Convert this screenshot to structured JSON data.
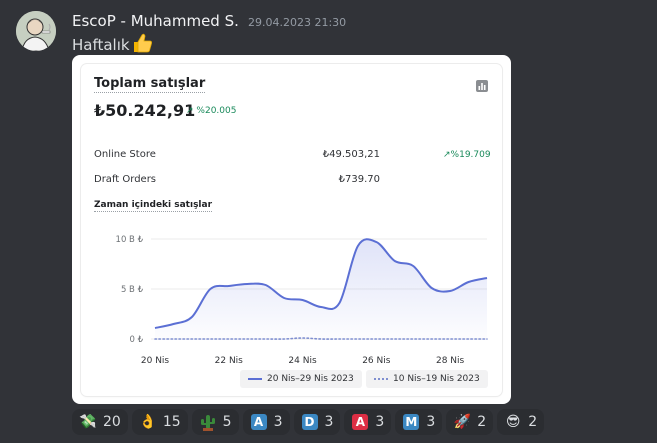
{
  "message": {
    "username": "EscoP - Muhammed S.",
    "timestamp": "29.04.2023 21:30",
    "text": "Haftalık",
    "emoji_icon": "thumbs-up-icon"
  },
  "card": {
    "title": "Toplam satışlar",
    "total": "₺50.242,91",
    "total_change": "%20.005",
    "rows": [
      {
        "label": "Online Store",
        "value": "₺49.503,21",
        "change": "%19.709"
      },
      {
        "label": "Draft Orders",
        "value": "₺739.70",
        "change": ""
      }
    ],
    "subtitle": "Zaman içindeki satışlar",
    "legend": [
      {
        "label": "20 Nis–29 Nis 2023"
      },
      {
        "label": "10 Nis–19 Nis 2023"
      }
    ]
  },
  "chart_data": {
    "type": "line",
    "x": [
      20,
      20.5,
      21,
      21.5,
      22,
      22.5,
      23,
      23.5,
      24,
      24.5,
      25,
      25.5,
      26,
      26.5,
      27,
      27.5,
      28,
      28.5,
      29
    ],
    "x_tick_labels": [
      "20 Nis",
      "22 Nis",
      "24 Nis",
      "26 Nis",
      "28 Nis"
    ],
    "x_tick_values": [
      20,
      22,
      24,
      26,
      28
    ],
    "y_tick_labels": [
      "10 B ₺",
      "5 B ₺",
      "0 ₺"
    ],
    "y_tick_values": [
      10000,
      5000,
      0
    ],
    "ylim": [
      0,
      10000
    ],
    "series": [
      {
        "name": "20 Nis–29 Nis 2023",
        "color": "#5b6fd4",
        "values": [
          1100,
          1500,
          2200,
          5000,
          5300,
          5500,
          5400,
          4100,
          3900,
          3200,
          3600,
          9300,
          9700,
          7800,
          7300,
          5100,
          4800,
          5700,
          6100
        ]
      },
      {
        "name": "10 Nis–19 Nis 2023",
        "color": "#7f8fd0",
        "values": [
          0,
          0,
          0,
          0,
          0,
          0,
          0,
          0,
          100,
          0,
          0,
          0,
          0,
          0,
          0,
          0,
          0,
          0,
          0
        ]
      }
    ]
  },
  "reactions": [
    {
      "icon": "money-with-wings-icon",
      "count": "20"
    },
    {
      "icon": "ok-hand-icon",
      "count": "15"
    },
    {
      "icon": "cactus-emote-icon",
      "count": "5"
    },
    {
      "icon": "letter-a-blue-icon",
      "letter": "A",
      "color": "#3b88c3",
      "count": "3"
    },
    {
      "icon": "letter-d-blue-icon",
      "letter": "D",
      "color": "#3b88c3",
      "count": "3"
    },
    {
      "icon": "letter-a-red-icon",
      "letter": "A",
      "color": "#dd2e44",
      "count": "3"
    },
    {
      "icon": "letter-m-blue-icon",
      "letter": "M",
      "color": "#3b88c3",
      "count": "3"
    },
    {
      "icon": "rocket-icon",
      "count": "2"
    },
    {
      "icon": "sunglasses-face-icon",
      "count": "2"
    }
  ]
}
